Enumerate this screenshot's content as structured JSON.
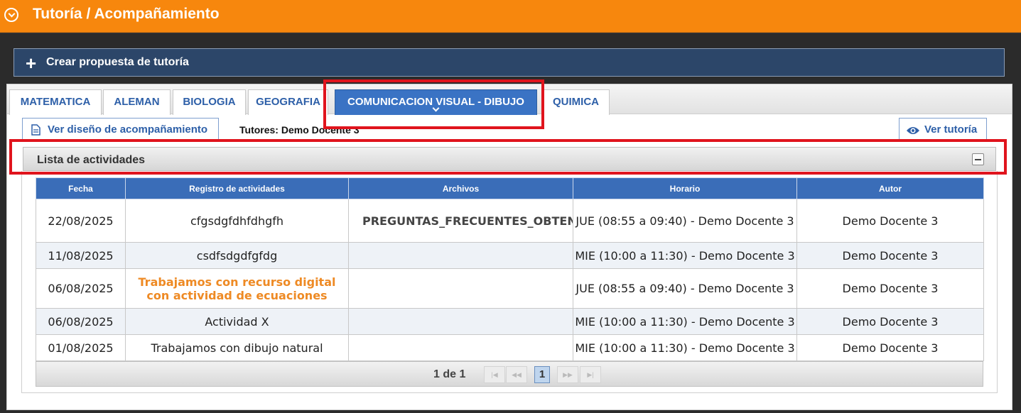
{
  "header": {
    "title": "Tutoría / Acompañamiento",
    "icon": "chevron-circle-icon"
  },
  "create_button": {
    "label": "Crear propuesta de tutoría",
    "icon": "plus-icon"
  },
  "tabs": [
    {
      "label": "MATEMATICA"
    },
    {
      "label": "ALEMAN"
    },
    {
      "label": "BIOLOGIA"
    },
    {
      "label": "GEOGRAFIA"
    },
    {
      "label": "COMUNICACION VISUAL - DIBUJO",
      "active": true
    },
    {
      "label": "QUIMICA"
    }
  ],
  "toolbar": {
    "design_button": "Ver diseño de acompañamiento",
    "tutores": "Tutores: Demo Docente 3",
    "view_button": "Ver tutoría"
  },
  "activities": {
    "title": "Lista de actividades",
    "columns": [
      "Fecha",
      "Registro de actividades",
      "Archivos",
      "Horario",
      "Autor"
    ],
    "rows": [
      {
        "fecha": "22/08/2025",
        "registro": "cfgsdgfdhfdhgfh",
        "archivo": "PREGUNTAS_FRECUENTES_OBTENER_LO",
        "horario": "JUE (08:55 a 09:40) - Demo Docente 3",
        "autor": "Demo Docente 3"
      },
      {
        "fecha": "11/08/2025",
        "registro": "csdfsdgdfgfdg",
        "archivo": "",
        "horario": "MIE (10:00 a 11:30) - Demo Docente 3",
        "autor": "Demo Docente 3"
      },
      {
        "fecha": "06/08/2025",
        "registro": "Trabajamos con recurso digital con actividad de ecuaciones",
        "archivo": "",
        "horario": "JUE (08:55 a 09:40) - Demo Docente 3",
        "autor": "Demo Docente 3"
      },
      {
        "fecha": "06/08/2025",
        "registro": "Actividad X",
        "archivo": "",
        "horario": "MIE (10:00 a 11:30) - Demo Docente 3",
        "autor": "Demo Docente 3"
      },
      {
        "fecha": "01/08/2025",
        "registro": "Trabajamos con dibujo natural",
        "archivo": "",
        "horario": "MIE (10:00 a 11:30) - Demo Docente 3",
        "autor": "Demo Docente 3"
      }
    ]
  },
  "pager": {
    "info": "1 de 1",
    "current_page": "1",
    "first": "|◀",
    "prev": "◀◀",
    "next": "▶▶",
    "last": "▶|"
  },
  "colors": {
    "header_orange": "#f7870d",
    "tab_active": "#3a73c4",
    "highlight_red": "#e0141d",
    "table_header": "#3a6db8"
  }
}
